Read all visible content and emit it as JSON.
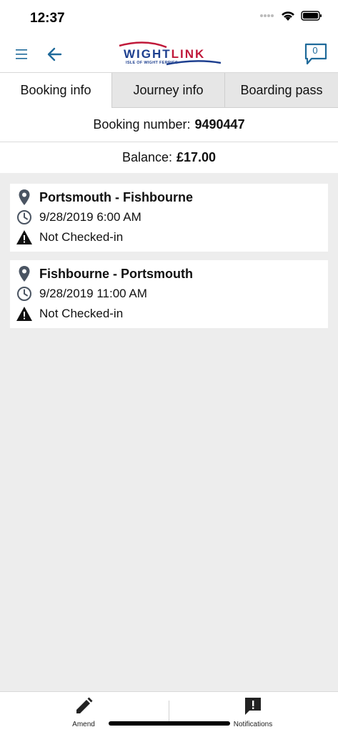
{
  "status_bar": {
    "time": "12:37"
  },
  "header": {
    "logo_main_part1": "WIGHT",
    "logo_main_part2": "LINK",
    "logo_sub": "ISLE OF WIGHT FERRIES",
    "notification_count": "0"
  },
  "tabs": [
    {
      "label": "Booking info",
      "active": true
    },
    {
      "label": "Journey info",
      "active": false
    },
    {
      "label": "Boarding pass",
      "active": false
    }
  ],
  "booking": {
    "number_label": "Booking number:",
    "number_value": "9490447",
    "balance_label": "Balance:",
    "balance_value": "£17.00"
  },
  "journeys": [
    {
      "route": "Portsmouth - Fishbourne",
      "datetime": "9/28/2019 6:00 AM",
      "status": "Not Checked-in"
    },
    {
      "route": "Fishbourne - Portsmouth",
      "datetime": "9/28/2019 11:00 AM",
      "status": "Not Checked-in"
    }
  ],
  "bottom_nav": {
    "amend_label": "Amend",
    "notifications_label": "Notifications"
  },
  "colors": {
    "brand_blue": "#1d3f8f",
    "brand_red": "#c0193a",
    "accent": "#1f6a9a"
  }
}
